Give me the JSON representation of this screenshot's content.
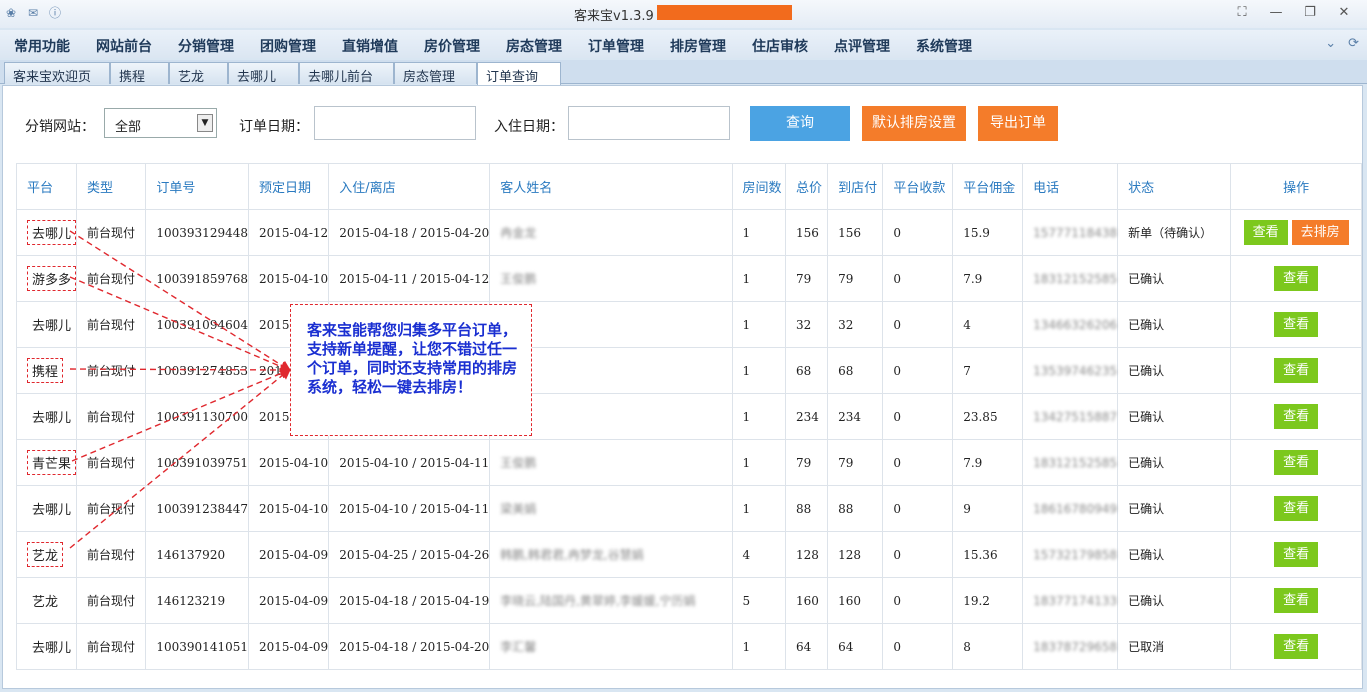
{
  "app": {
    "title": "客来宝v1.3.9 -",
    "title_redaction_color": "#f26b1d"
  },
  "titlebar_icons": [
    "app-logo-icon",
    "mail-icon",
    "info-icon"
  ],
  "window_controls": [
    "restore-screen-icon",
    "minimize-icon",
    "maximize-icon",
    "close-icon"
  ],
  "menu": [
    "常用功能",
    "网站前台",
    "分销管理",
    "团购管理",
    "直销增值",
    "房价管理",
    "房态管理",
    "订单管理",
    "排房管理",
    "住店审核",
    "点评管理",
    "系统管理"
  ],
  "tabs": [
    {
      "label": "客来宝欢迎页",
      "active": false
    },
    {
      "label": "携程",
      "active": false
    },
    {
      "label": "艺龙",
      "active": false
    },
    {
      "label": "去哪儿",
      "active": false
    },
    {
      "label": "去哪儿前台",
      "active": false
    },
    {
      "label": "房态管理",
      "active": false
    },
    {
      "label": "订单查询",
      "active": true
    }
  ],
  "tab_close_symbol": "✕",
  "filters": {
    "site_label": "分销网站：",
    "site_value": "全部",
    "order_date_label": "订单日期：",
    "order_date_value": "",
    "checkin_date_label": "入住日期：",
    "checkin_date_value": ""
  },
  "buttons": {
    "query": "查询",
    "default_rooming": "默认排房设置",
    "export": "导出订单"
  },
  "colors": {
    "query_button": "#4ba3e3",
    "orange_button": "#f47c2a",
    "green_button": "#7cc81d",
    "header_text": "#2a7ac0",
    "annotation_red": "#e0282e",
    "annotation_text": "#1a2fd1"
  },
  "table": {
    "headers": [
      "平台",
      "类型",
      "订单号",
      "预定日期",
      "入住/离店",
      "客人姓名",
      "房间数",
      "总价",
      "到店付",
      "平台收款",
      "平台佣金",
      "电话",
      "状态",
      "操作"
    ],
    "rows": [
      {
        "platform": "去哪儿",
        "type": "前台现付",
        "order_no": "100393129448",
        "booked": "2015-04-12",
        "stay": "2015-04-18 / 2015-04-20",
        "guest": "冉金龙",
        "rooms": "1",
        "total": "156",
        "pay_at_hotel": "156",
        "platform_recv": "0",
        "commission": "15.9",
        "phone": "15777118438",
        "status": "新单（待确认）",
        "actions": [
          "查看",
          "去排房"
        ],
        "highlight": true
      },
      {
        "platform": "游多多",
        "type": "前台现付",
        "order_no": "100391859768",
        "booked": "2015-04-10",
        "stay": "2015-04-11 / 2015-04-12",
        "guest": "王俊鹏",
        "rooms": "1",
        "total": "79",
        "pay_at_hotel": "79",
        "platform_recv": "0",
        "commission": "7.9",
        "phone": "18312152585",
        "status": "已确认",
        "actions": [
          "查看"
        ],
        "highlight": true
      },
      {
        "platform": "去哪儿",
        "type": "前台现付",
        "order_no": "100391094604",
        "booked": "2015-04-",
        "stay": "",
        "guest": "",
        "rooms": "1",
        "total": "32",
        "pay_at_hotel": "32",
        "platform_recv": "0",
        "commission": "4",
        "phone": "13466326206",
        "status": "已确认",
        "actions": [
          "查看"
        ],
        "highlight": false
      },
      {
        "platform": "携程",
        "type": "前台现付",
        "order_no": "100391274853",
        "booked": "2015-0",
        "stay": "",
        "guest": "",
        "rooms": "1",
        "total": "68",
        "pay_at_hotel": "68",
        "platform_recv": "0",
        "commission": "7",
        "phone": "13539746235",
        "status": "已确认",
        "actions": [
          "查看"
        ],
        "highlight": true
      },
      {
        "platform": "去哪儿",
        "type": "前台现付",
        "order_no": "100391130700",
        "booked": "2015-04-",
        "stay": "",
        "guest": "",
        "rooms": "1",
        "total": "234",
        "pay_at_hotel": "234",
        "platform_recv": "0",
        "commission": "23.85",
        "phone": "13427515887",
        "status": "已确认",
        "actions": [
          "查看"
        ],
        "highlight": false
      },
      {
        "platform": "青芒果",
        "type": "前台现付",
        "order_no": "100391039751",
        "booked": "2015-04-10",
        "stay": "2015-04-10 / 2015-04-11",
        "guest": "王俊鹏",
        "rooms": "1",
        "total": "79",
        "pay_at_hotel": "79",
        "platform_recv": "0",
        "commission": "7.9",
        "phone": "18312152585",
        "status": "已确认",
        "actions": [
          "查看"
        ],
        "highlight": true
      },
      {
        "platform": "去哪儿",
        "type": "前台现付",
        "order_no": "100391238447",
        "booked": "2015-04-10",
        "stay": "2015-04-10 / 2015-04-11",
        "guest": "梁美娟",
        "rooms": "1",
        "total": "88",
        "pay_at_hotel": "88",
        "platform_recv": "0",
        "commission": "9",
        "phone": "18616780949",
        "status": "已确认",
        "actions": [
          "查看"
        ],
        "highlight": false
      },
      {
        "platform": "艺龙",
        "type": "前台现付",
        "order_no": "146137920",
        "booked": "2015-04-09",
        "stay": "2015-04-25 / 2015-04-26",
        "guest": "韩鹏,韩君君,冉梦龙,谷慧娟",
        "rooms": "4",
        "total": "128",
        "pay_at_hotel": "128",
        "platform_recv": "0",
        "commission": "15.36",
        "phone": "15732179858",
        "status": "已确认",
        "actions": [
          "查看"
        ],
        "highlight": true
      },
      {
        "platform": "艺龙",
        "type": "前台现付",
        "order_no": "146123219",
        "booked": "2015-04-09",
        "stay": "2015-04-18 / 2015-04-19",
        "guest": "李晓云,陆国丹,黄翠婷,李媛媛,宁历娟",
        "rooms": "5",
        "total": "160",
        "pay_at_hotel": "160",
        "platform_recv": "0",
        "commission": "19.2",
        "phone": "18377174133",
        "status": "已确认",
        "actions": [
          "查看"
        ],
        "highlight": false
      },
      {
        "platform": "去哪儿",
        "type": "前台现付",
        "order_no": "100390141051",
        "booked": "2015-04-09",
        "stay": "2015-04-18 / 2015-04-20",
        "guest": "李汇馨",
        "rooms": "1",
        "total": "64",
        "pay_at_hotel": "64",
        "platform_recv": "0",
        "commission": "8",
        "phone": "18378729658",
        "status": "已取消",
        "actions": [
          "查看"
        ],
        "highlight": false
      }
    ]
  },
  "annotation": {
    "text": "客来宝能帮您归集多平台订单，支持新单提醒，让您不错过任一个订单，同时还支持常用的排房系统，轻松一键去排房！"
  }
}
